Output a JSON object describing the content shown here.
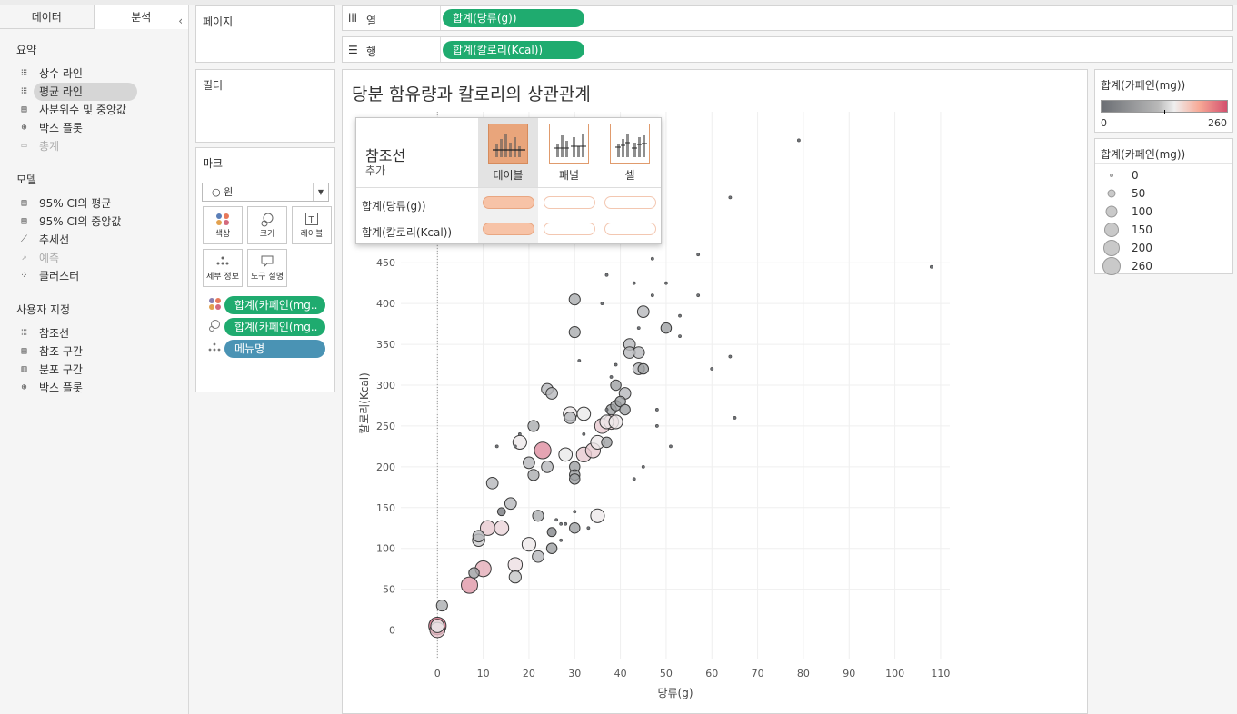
{
  "left_panel": {
    "tabs": [
      "데이터",
      "분석"
    ],
    "collapse": "‹",
    "sections": [
      {
        "title": "요약",
        "items": [
          {
            "label": "상수 라인",
            "icon": "constant-line-icon",
            "glyph": "⁝⁝⁝"
          },
          {
            "label": "평균 라인",
            "icon": "average-line-icon",
            "glyph": "⁝⁝⁝",
            "selected": true
          },
          {
            "label": "사분위수 및 중앙값",
            "icon": "quartile-icon",
            "glyph": "▤"
          },
          {
            "label": "박스 플롯",
            "icon": "box-plot-icon",
            "glyph": "⊕"
          },
          {
            "label": "총계",
            "icon": "totals-icon",
            "glyph": "▭",
            "disabled": true
          }
        ]
      },
      {
        "title": "모델",
        "items": [
          {
            "label": "95% CI의 평균",
            "icon": "ci-mean-icon",
            "glyph": "▤"
          },
          {
            "label": "95% CI의 중앙값",
            "icon": "ci-median-icon",
            "glyph": "▤"
          },
          {
            "label": "추세선",
            "icon": "trend-line-icon",
            "glyph": "⟋"
          },
          {
            "label": "예측",
            "icon": "forecast-icon",
            "glyph": "↗",
            "disabled": true
          },
          {
            "label": "클러스터",
            "icon": "cluster-icon",
            "glyph": "⁘"
          }
        ]
      },
      {
        "title": "사용자 지정",
        "items": [
          {
            "label": "참조선",
            "icon": "reference-line-icon",
            "glyph": "⁝⁝⁝"
          },
          {
            "label": "참조 구간",
            "icon": "reference-band-icon",
            "glyph": "▤"
          },
          {
            "label": "분포 구간",
            "icon": "distribution-band-icon",
            "glyph": "▥"
          },
          {
            "label": "박스 플롯",
            "icon": "box-plot-custom-icon",
            "glyph": "⊕"
          }
        ]
      }
    ]
  },
  "pages_card": {
    "title": "페이지"
  },
  "filters_card": {
    "title": "필터"
  },
  "marks_card": {
    "title": "마크",
    "mark_type": "○  원",
    "buttons": [
      {
        "label": "색상",
        "glyph": "●●"
      },
      {
        "label": "크기",
        "glyph": "◌"
      },
      {
        "label": "레이블",
        "glyph": "T"
      },
      {
        "label": "세부 정보",
        "glyph": "∴"
      },
      {
        "label": "도구 설명",
        "glyph": "▭"
      }
    ],
    "fields": [
      {
        "label": "합계(카페인(mg..",
        "kind": "color"
      },
      {
        "label": "합계(카페인(mg..",
        "kind": "size"
      },
      {
        "label": "메뉴명",
        "kind": "detail"
      }
    ]
  },
  "shelves": {
    "columns": {
      "label": "열",
      "glyph": "iii",
      "pill": "합계(당류(g))"
    },
    "rows": {
      "label": "행",
      "glyph": "☰",
      "pill": "합계(칼로리(Kcal))"
    }
  },
  "view": {
    "title": "당분 함유량과 칼로리의 상관관계"
  },
  "popup": {
    "title": "참조선",
    "subtitle": "추가",
    "columns": [
      "테이블",
      "패널",
      "셀"
    ],
    "rows": [
      "합계(당류(g))",
      "합계(칼로리(Kcal))"
    ]
  },
  "color_legend": {
    "title": "합계(카페인(mg))",
    "min": "0",
    "max": "260"
  },
  "size_legend": {
    "title": "합계(카페인(mg))",
    "items": [
      "0",
      "50",
      "100",
      "150",
      "200",
      "260"
    ]
  },
  "chart_data": {
    "type": "scatter",
    "xlabel": "당류(g)",
    "ylabel": "칼로리(Kcal)",
    "xlim": [
      -8,
      112
    ],
    "ylim": [
      -35,
      635
    ],
    "xticks": [
      0,
      10,
      20,
      30,
      40,
      50,
      60,
      70,
      80,
      90,
      100,
      110
    ],
    "yticks": [
      0,
      50,
      100,
      150,
      200,
      250,
      300,
      350,
      400,
      450
    ],
    "color_scale": {
      "min": 0,
      "max": 260,
      "low": "#6b6e73",
      "mid": "#efefef",
      "high": "#d4506e"
    },
    "points": [
      [
        0,
        5,
        230
      ],
      [
        0,
        0,
        150
      ],
      [
        0,
        5,
        100
      ],
      [
        1,
        30,
        50
      ],
      [
        7,
        55,
        190
      ],
      [
        10,
        75,
        170
      ],
      [
        8,
        70,
        40
      ],
      [
        9,
        110,
        75
      ],
      [
        9,
        115,
        60
      ],
      [
        11,
        125,
        140
      ],
      [
        14,
        125,
        130
      ],
      [
        14,
        145,
        10
      ],
      [
        12,
        180,
        60
      ],
      [
        16,
        155,
        60
      ],
      [
        17,
        80,
        120
      ],
      [
        17,
        65,
        70
      ],
      [
        18,
        230,
        110
      ],
      [
        18,
        240,
        5
      ],
      [
        17,
        225,
        5
      ],
      [
        13,
        225,
        5
      ],
      [
        20,
        105,
        110
      ],
      [
        21,
        190,
        50
      ],
      [
        20,
        205,
        60
      ],
      [
        21,
        250,
        50
      ],
      [
        22,
        90,
        60
      ],
      [
        23,
        220,
        200
      ],
      [
        22,
        140,
        50
      ],
      [
        24,
        200,
        60
      ],
      [
        24,
        295,
        60
      ],
      [
        25,
        290,
        60
      ],
      [
        25,
        100,
        40
      ],
      [
        25,
        120,
        20
      ],
      [
        26,
        135,
        5
      ],
      [
        27,
        110,
        5
      ],
      [
        27,
        130,
        5
      ],
      [
        28,
        130,
        5
      ],
      [
        29,
        265,
        110
      ],
      [
        29,
        260,
        60
      ],
      [
        28,
        215,
        100
      ],
      [
        30,
        125,
        40
      ],
      [
        30,
        145,
        5
      ],
      [
        30,
        200,
        40
      ],
      [
        30,
        190,
        40
      ],
      [
        30,
        185,
        40
      ],
      [
        30,
        365,
        50
      ],
      [
        30,
        405,
        50
      ],
      [
        31,
        330,
        5
      ],
      [
        32,
        240,
        5
      ],
      [
        32,
        265,
        100
      ],
      [
        32,
        215,
        140
      ],
      [
        33,
        125,
        5
      ],
      [
        34,
        220,
        140
      ],
      [
        35,
        230,
        110
      ],
      [
        35,
        140,
        110
      ],
      [
        36,
        250,
        140
      ],
      [
        37,
        255,
        110
      ],
      [
        37,
        230,
        40
      ],
      [
        36,
        400,
        5
      ],
      [
        37,
        435,
        5
      ],
      [
        38,
        255,
        140
      ],
      [
        38,
        310,
        5
      ],
      [
        39,
        325,
        5
      ],
      [
        39,
        300,
        40
      ],
      [
        38,
        270,
        40
      ],
      [
        37,
        270,
        5
      ],
      [
        39,
        255,
        110
      ],
      [
        39,
        275,
        40
      ],
      [
        40,
        280,
        40
      ],
      [
        41,
        270,
        40
      ],
      [
        41,
        290,
        60
      ],
      [
        42,
        350,
        60
      ],
      [
        42,
        340,
        60
      ],
      [
        43,
        185,
        5
      ],
      [
        43,
        425,
        5
      ],
      [
        44,
        320,
        60
      ],
      [
        44,
        340,
        60
      ],
      [
        45,
        320,
        40
      ],
      [
        45,
        200,
        5
      ],
      [
        44,
        370,
        5
      ],
      [
        45,
        390,
        60
      ],
      [
        47,
        410,
        5
      ],
      [
        47,
        455,
        5
      ],
      [
        48,
        250,
        5
      ],
      [
        48,
        270,
        5
      ],
      [
        50,
        425,
        5
      ],
      [
        50,
        370,
        40
      ],
      [
        51,
        225,
        5
      ],
      [
        53,
        385,
        5
      ],
      [
        53,
        360,
        5
      ],
      [
        57,
        410,
        5
      ],
      [
        57,
        460,
        5
      ],
      [
        60,
        320,
        5
      ],
      [
        64,
        335,
        5
      ],
      [
        64,
        530,
        5
      ],
      [
        65,
        260,
        5
      ],
      [
        79,
        600,
        5
      ],
      [
        108,
        445,
        5
      ]
    ]
  }
}
